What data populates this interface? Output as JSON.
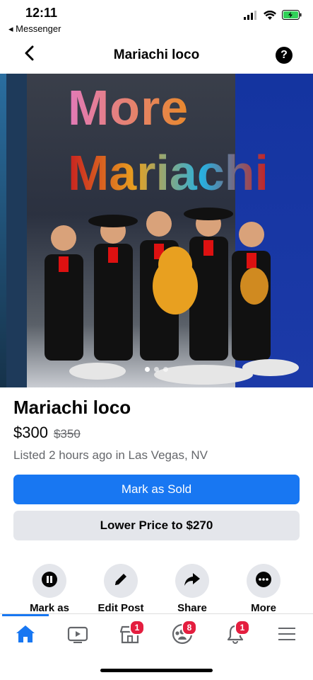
{
  "status": {
    "time": "12:11",
    "back_app": "◂ Messenger"
  },
  "nav": {
    "title": "Mariachi loco",
    "help": "?"
  },
  "photo": {
    "line1": "More",
    "line2": "Mariachi",
    "dots": 3
  },
  "listing": {
    "title": "Mariachi loco",
    "price": "$300",
    "old_price": "$350",
    "listed": "Listed 2 hours ago in Las Vegas, NV"
  },
  "buttons": {
    "mark_sold": "Mark as Sold",
    "lower_price": "Lower Price to $270"
  },
  "actions": [
    {
      "label": "Mark as"
    },
    {
      "label": "Edit Post"
    },
    {
      "label": "Share"
    },
    {
      "label": "More"
    }
  ],
  "tabs": {
    "marketplace_badge": "1",
    "groups_badge": "8",
    "notifications_badge": "1"
  },
  "colors": {
    "accent": "#1877f2",
    "badge": "#e41e3f",
    "battery": "#31d158"
  }
}
